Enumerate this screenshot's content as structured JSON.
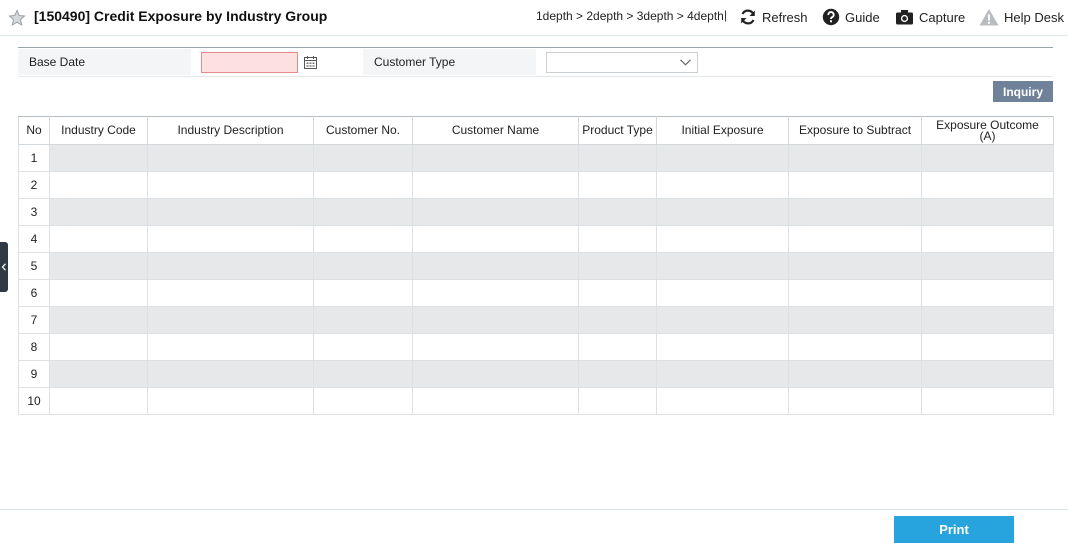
{
  "header": {
    "title": "[150490] Credit Exposure by Industry Group",
    "breadcrumb": "1depth > 2depth > 3depth > 4depth",
    "separator": "|",
    "tools": [
      {
        "label": "Refresh",
        "icon": "refresh-icon"
      },
      {
        "label": "Guide",
        "icon": "help-icon"
      },
      {
        "label": "Capture",
        "icon": "camera-icon"
      },
      {
        "label": "Help Desk",
        "icon": "warning-icon"
      }
    ]
  },
  "search": {
    "base_date_label": "Base Date",
    "base_date_value": "",
    "customer_type_label": "Customer Type",
    "customer_type_value": "",
    "inquiry_label": "Inquiry"
  },
  "grid": {
    "columns": [
      "No",
      "Industry Code",
      "Industry Description",
      "Customer No.",
      "Customer Name",
      "Product Type",
      "Initial Exposure",
      "Exposure to Subtract",
      "Exposure Outcome\n(A)"
    ],
    "row_numbers": [
      "1",
      "2",
      "3",
      "4",
      "5",
      "6",
      "7",
      "8",
      "9",
      "10"
    ]
  },
  "footer": {
    "print_label": "Print"
  },
  "colors": {
    "accent": "#27a3de",
    "inquiry_button": "#6f8299",
    "required_field": "#fde0e0",
    "row_stripe": "#e7e8e9"
  }
}
